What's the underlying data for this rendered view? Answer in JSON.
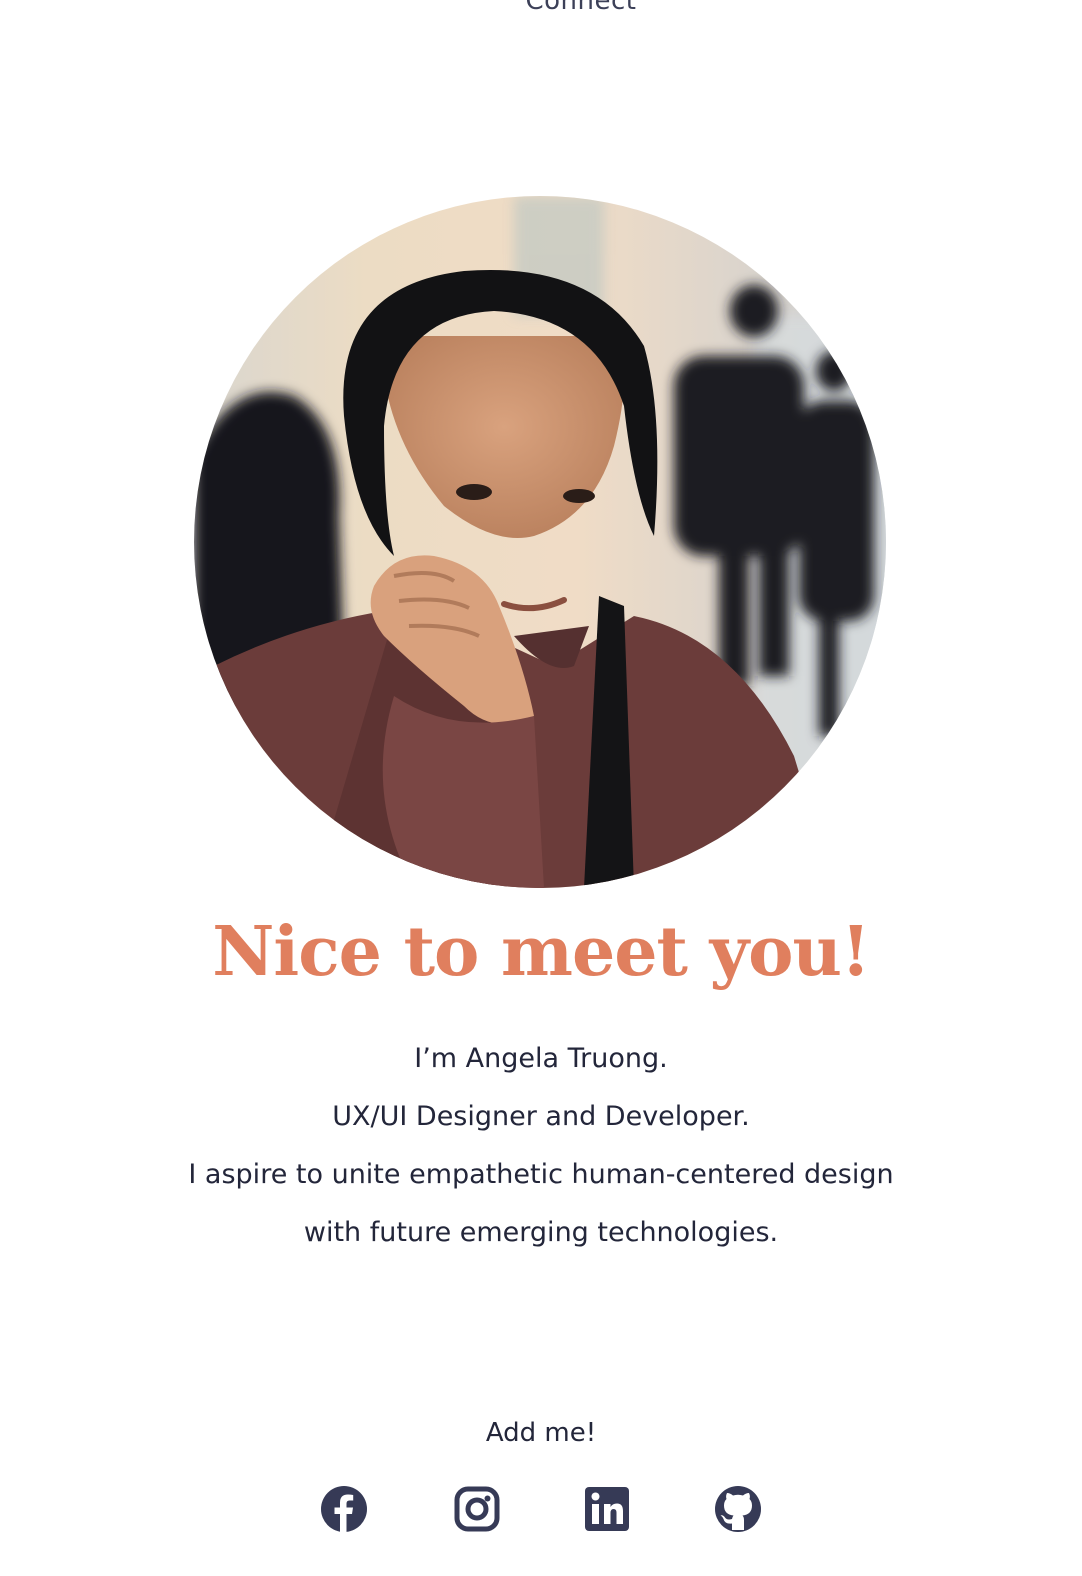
{
  "nav": {
    "connect_label": "Connect"
  },
  "hero": {
    "greeting": "Nice to meet you!",
    "intro_lines": [
      "I’m Angela Truong.",
      "UX/UI Designer and Developer.",
      "I aspire to unite empathetic human-centered design",
      "with future emerging technologies."
    ]
  },
  "social": {
    "heading": "Add me!",
    "links": [
      {
        "icon": "facebook-icon"
      },
      {
        "icon": "instagram-icon"
      },
      {
        "icon": "linkedin-icon"
      },
      {
        "icon": "github-icon"
      }
    ]
  },
  "colors": {
    "accent": "#e07f5e",
    "text": "#23263a",
    "icon": "#363a56",
    "background": "#ffffff"
  }
}
